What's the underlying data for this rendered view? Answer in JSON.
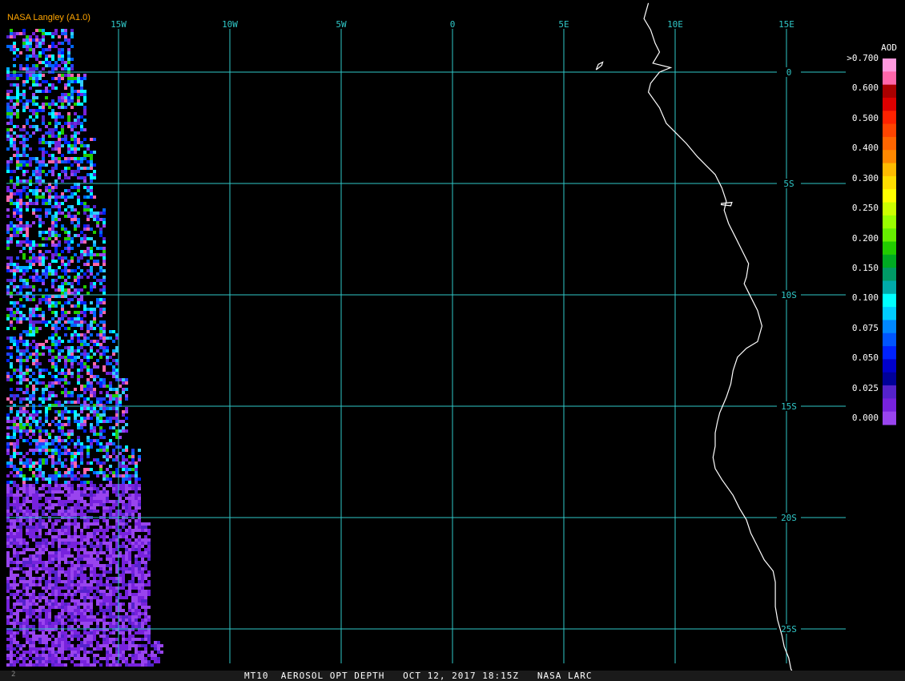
{
  "header": {
    "credit": "NASA Langley (A1.0)"
  },
  "footer": {
    "caption": "MT10  AEROSOL OPT DEPTH   OCT 12, 2017 18:15Z   NASA LARC",
    "corner_mark": "2"
  },
  "colors": {
    "grid": "#30c8c8",
    "label": "#30c8c8",
    "coast": "#ffffff",
    "credit": "#ffa500"
  },
  "grid": {
    "longitudes": [
      {
        "lon": -15,
        "label": "15W"
      },
      {
        "lon": -10,
        "label": "10W"
      },
      {
        "lon": -5,
        "label": "5W"
      },
      {
        "lon": 0,
        "label": "0"
      },
      {
        "lon": 5,
        "label": "5E"
      },
      {
        "lon": 10,
        "label": "10E"
      },
      {
        "lon": 15,
        "label": "15E"
      }
    ],
    "latitudes": [
      {
        "lat": 0,
        "label": "0"
      },
      {
        "lat": -5,
        "label": "5S"
      },
      {
        "lat": -10,
        "label": "10S"
      },
      {
        "lat": -15,
        "label": "15S"
      },
      {
        "lat": -20,
        "label": "20S"
      },
      {
        "lat": -25,
        "label": "25S"
      }
    ]
  },
  "colorbar": {
    "title": "AOD",
    "labels": [
      ">0.700",
      "0.600",
      "0.500",
      "0.400",
      "0.300",
      "0.250",
      "0.200",
      "0.150",
      "0.100",
      "0.075",
      "0.050",
      "0.025",
      "0.000"
    ],
    "colors": [
      "#ff99dd",
      "#ff66aa",
      "#aa0000",
      "#dd0000",
      "#ff2200",
      "#ff4400",
      "#ff6600",
      "#ff8800",
      "#ffbb00",
      "#ffdd00",
      "#ffff00",
      "#ccff00",
      "#99ff00",
      "#66ee00",
      "#22cc00",
      "#00aa22",
      "#009966",
      "#00aaaa",
      "#00ffff",
      "#00ccff",
      "#0088ff",
      "#0055ff",
      "#0022ff",
      "#0000cc",
      "#000099",
      "#5522cc",
      "#7722dd",
      "#9944ee"
    ]
  },
  "coastline": [
    [
      8.8,
      3.1
    ],
    [
      8.6,
      2.4
    ],
    [
      8.9,
      1.9
    ],
    [
      9.1,
      1.3
    ],
    [
      9.3,
      0.9
    ],
    [
      9.0,
      0.4
    ],
    [
      9.8,
      0.2
    ],
    [
      9.3,
      0.0
    ],
    [
      8.9,
      -0.5
    ],
    [
      8.8,
      -0.9
    ],
    [
      9.3,
      -1.6
    ],
    [
      9.6,
      -2.3
    ],
    [
      10.1,
      -2.8
    ],
    [
      10.5,
      -3.2
    ],
    [
      11.0,
      -3.8
    ],
    [
      11.4,
      -4.2
    ],
    [
      11.8,
      -4.6
    ],
    [
      12.1,
      -5.2
    ],
    [
      12.3,
      -5.8
    ],
    [
      12.2,
      -6.2
    ],
    [
      12.4,
      -6.8
    ],
    [
      12.7,
      -7.4
    ],
    [
      13.0,
      -8.0
    ],
    [
      13.3,
      -8.6
    ],
    [
      13.2,
      -9.2
    ],
    [
      13.1,
      -9.5
    ],
    [
      13.4,
      -10.1
    ],
    [
      13.7,
      -10.7
    ],
    [
      13.9,
      -11.4
    ],
    [
      13.7,
      -12.1
    ],
    [
      13.2,
      -12.4
    ],
    [
      12.8,
      -12.8
    ],
    [
      12.6,
      -13.4
    ],
    [
      12.5,
      -14.0
    ],
    [
      12.3,
      -14.6
    ],
    [
      12.0,
      -15.3
    ],
    [
      11.9,
      -15.7
    ],
    [
      11.8,
      -16.2
    ],
    [
      11.8,
      -16.8
    ],
    [
      11.7,
      -17.3
    ],
    [
      11.8,
      -17.8
    ],
    [
      12.1,
      -18.3
    ],
    [
      12.6,
      -19.0
    ],
    [
      12.9,
      -19.6
    ],
    [
      13.2,
      -20.1
    ],
    [
      13.4,
      -20.7
    ],
    [
      13.7,
      -21.3
    ],
    [
      14.0,
      -21.9
    ],
    [
      14.4,
      -22.4
    ],
    [
      14.5,
      -22.9
    ],
    [
      14.5,
      -23.4
    ],
    [
      14.5,
      -24.0
    ],
    [
      14.6,
      -24.6
    ],
    [
      14.8,
      -25.3
    ],
    [
      14.9,
      -25.8
    ],
    [
      15.1,
      -26.3
    ],
    [
      15.2,
      -26.8
    ],
    [
      15.5,
      -27.4
    ]
  ],
  "islands": [
    [
      [
        6.45,
        0.1
      ],
      [
        6.7,
        0.3
      ],
      [
        6.75,
        0.45
      ],
      [
        6.55,
        0.35
      ],
      [
        6.45,
        0.1
      ]
    ],
    [
      [
        12.05,
        -5.9
      ],
      [
        12.55,
        -5.85
      ],
      [
        12.5,
        -6.0
      ],
      [
        12.05,
        -5.95
      ]
    ]
  ]
}
